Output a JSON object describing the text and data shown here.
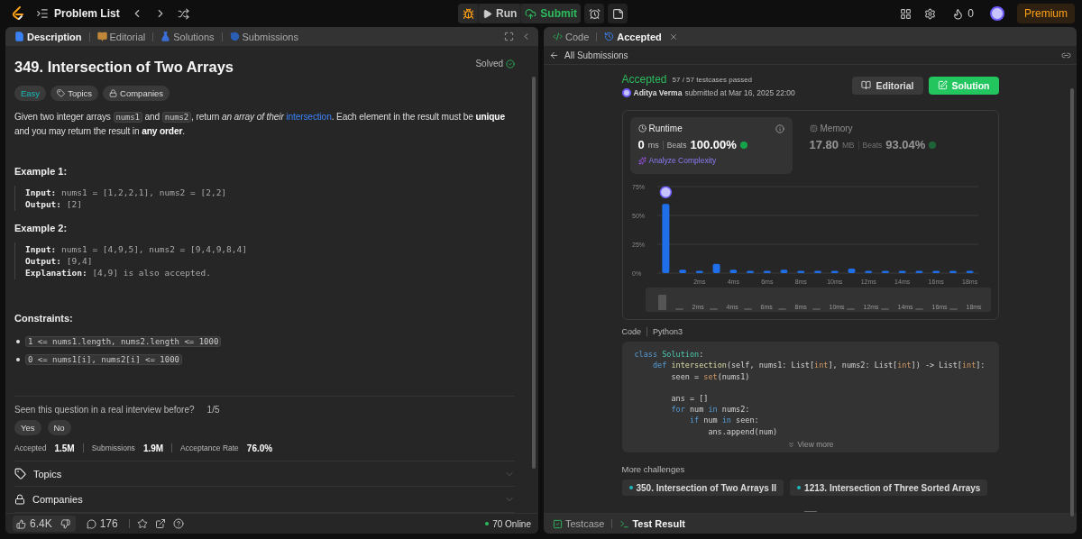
{
  "top_bar": {
    "title": "Problem List",
    "run": "Run",
    "submit": "Submit",
    "streak": "0",
    "premium": "Premium"
  },
  "left_tabs": [
    {
      "label": "Description",
      "selected": true,
      "color": "#3b82f6"
    },
    {
      "label": "Editorial",
      "selected": false,
      "color": "#c0883a"
    },
    {
      "label": "Solutions",
      "selected": false,
      "color": "#3b6fd6"
    },
    {
      "label": "Submissions",
      "selected": false,
      "color": "#2b5fb5"
    }
  ],
  "problem": {
    "title": "349. Intersection of Two Arrays",
    "status": "Solved",
    "difficulty": "Easy",
    "tags": [
      "Topics",
      "Companies"
    ],
    "description": [
      {
        "kind": "plain",
        "text": "Given two integer arrays "
      },
      {
        "kind": "code",
        "text": "nums1"
      },
      {
        "kind": "plain",
        "text": " and "
      },
      {
        "kind": "code",
        "text": "nums2"
      },
      {
        "kind": "plain",
        "text": ", return "
      },
      {
        "kind": "italic",
        "text": "an array of their "
      },
      {
        "kind": "link",
        "text": "intersection"
      },
      {
        "kind": "plain",
        "text": ". Each element in the result must be "
      },
      {
        "kind": "bold",
        "text": "unique"
      },
      {
        "kind": "plain",
        "text": " and you may return the result in "
      },
      {
        "kind": "bold",
        "text": "any order"
      },
      {
        "kind": "plain",
        "text": "."
      }
    ],
    "examples": [
      {
        "title": "Example 1:",
        "lines": [
          {
            "label": "Input:",
            "value": "nums1 = [1,2,2,1], nums2 = [2,2]"
          },
          {
            "label": "Output:",
            "value": "[2]"
          }
        ]
      },
      {
        "title": "Example 2:",
        "lines": [
          {
            "label": "Input:",
            "value": "nums1 = [4,9,5], nums2 = [9,4,9,8,4]"
          },
          {
            "label": "Output:",
            "value": "[9,4]"
          },
          {
            "label": "Explanation:",
            "value": "[4,9] is also accepted."
          }
        ]
      }
    ],
    "constraints_title": "Constraints:",
    "constraints": [
      "1 <= nums1.length, nums2.length <= 1000",
      "0 <= nums1[i], nums2[i] <= 1000"
    ],
    "interview_question": "Seen this question in a real interview before?",
    "interview_count": "1/5",
    "answers": [
      "Yes",
      "No"
    ],
    "stats": [
      {
        "label": "Accepted",
        "value": "1.5M"
      },
      {
        "label": "Submissions",
        "value": "1.9M"
      },
      {
        "label": "Acceptance Rate",
        "value": "76.0%"
      }
    ],
    "sections": [
      {
        "kind": "tag",
        "label": "Topics",
        "expanded": false
      },
      {
        "kind": "lock",
        "label": "Companies",
        "expanded": false
      }
    ]
  },
  "left_footer": {
    "likes": "6.4K",
    "comments": "176",
    "online": "70 Online"
  },
  "right_tabs": [
    {
      "label": "Code",
      "selected": false
    },
    {
      "label": "Accepted",
      "selected": true
    }
  ],
  "submission": {
    "back": "All Submissions",
    "status": "Accepted",
    "testcases": "57 / 57 testcases passed",
    "author": "Aditya Verma",
    "submitted": "submitted at Mar 16, 2025 22:00",
    "buttons": [
      "Editorial",
      "Solution"
    ],
    "metrics": [
      {
        "kind": "clock",
        "label": "Runtime",
        "value": "0",
        "unit": "ms",
        "beats_label": "Beats",
        "beats": "100.00%",
        "selected": true,
        "extra": "Analyze Complexity"
      },
      {
        "kind": "chip",
        "label": "Memory",
        "value": "17.80",
        "unit": "MB",
        "beats_label": "Beats",
        "beats": "93.04%",
        "selected": false
      }
    ],
    "chart_data": {
      "type": "bar",
      "x": [
        0,
        1,
        2,
        3,
        4,
        5,
        6,
        7,
        8,
        9,
        10,
        11,
        12,
        13,
        14,
        15,
        16,
        17,
        18
      ],
      "values": [
        60,
        3,
        2,
        8,
        3,
        2,
        2,
        3,
        2,
        2,
        2,
        4,
        2,
        2,
        2,
        2,
        2,
        2,
        2
      ],
      "ylim": [
        0,
        75
      ],
      "yticks": [
        {
          "value": 0,
          "label": "0%"
        },
        {
          "value": 25,
          "label": "25%"
        },
        {
          "value": 50,
          "label": "50%"
        },
        {
          "value": 75,
          "label": "75%"
        }
      ],
      "xlim": [
        -0.5,
        18.5
      ],
      "xticks": [
        {
          "value": 2,
          "label": "2ms"
        },
        {
          "value": 4,
          "label": "4ms"
        },
        {
          "value": 6,
          "label": "6ms"
        },
        {
          "value": 8,
          "label": "8ms"
        },
        {
          "value": 10,
          "label": "10ms"
        },
        {
          "value": 12,
          "label": "12ms"
        },
        {
          "value": 14,
          "label": "14ms"
        },
        {
          "value": 16,
          "label": "16ms"
        },
        {
          "value": 18,
          "label": "18ms"
        }
      ]
    },
    "navigator_labels": [
      "2ms",
      "4ms",
      "6ms",
      "8ms",
      "10ms",
      "12ms",
      "14ms",
      "16ms",
      "18ms"
    ],
    "code_label": "Code",
    "language": "Python3",
    "code": [
      {
        "tokens": [
          {
            "kind": "keyword",
            "text": "class "
          },
          {
            "kind": "class",
            "text": "Solution"
          },
          {
            "kind": "plain",
            "text": ":"
          }
        ]
      },
      {
        "tokens": [
          {
            "kind": "keyword",
            "text": "    def "
          },
          {
            "kind": "function",
            "text": "intersection"
          },
          {
            "kind": "plain",
            "text": "(self, nums1: List["
          },
          {
            "kind": "builtin",
            "text": "int"
          },
          {
            "kind": "plain",
            "text": "], nums2: List["
          },
          {
            "kind": "builtin",
            "text": "int"
          },
          {
            "kind": "plain",
            "text": "]) -> List["
          },
          {
            "kind": "builtin",
            "text": "int"
          },
          {
            "kind": "plain",
            "text": "]:"
          }
        ]
      },
      {
        "tokens": [
          {
            "kind": "plain",
            "text": "        seen = "
          },
          {
            "kind": "builtin",
            "text": "set"
          },
          {
            "kind": "plain",
            "text": "(nums1)"
          }
        ]
      },
      {
        "spaced": true,
        "tokens": [
          {
            "kind": "plain",
            "text": "        ans = []"
          }
        ]
      },
      {
        "tokens": [
          {
            "kind": "keyword",
            "text": "        for "
          },
          {
            "kind": "plain",
            "text": "num "
          },
          {
            "kind": "keyword",
            "text": "in "
          },
          {
            "kind": "plain",
            "text": "nums2:"
          }
        ]
      },
      {
        "tokens": [
          {
            "kind": "keyword",
            "text": "            if "
          },
          {
            "kind": "plain",
            "text": "num "
          },
          {
            "kind": "keyword",
            "text": "in "
          },
          {
            "kind": "plain",
            "text": "seen:"
          }
        ]
      },
      {
        "tokens": [
          {
            "kind": "plain",
            "text": "                ans.append(num)"
          }
        ]
      }
    ],
    "view_more": "View more",
    "more_title": "More challenges",
    "challenges": [
      "350. Intersection of Two Arrays II",
      "1213. Intersection of Three Sorted Arrays"
    ]
  },
  "bottom_tabs": [
    {
      "label": "Testcase",
      "selected": false
    },
    {
      "label": "Test Result",
      "selected": true
    }
  ]
}
